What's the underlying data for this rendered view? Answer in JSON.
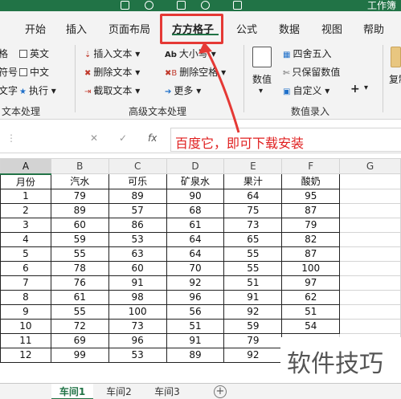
{
  "title_bar": {
    "title": "工作簿"
  },
  "tabs": [
    "开始",
    "插入",
    "页面布局",
    "方方格子",
    "公式",
    "数据",
    "视图",
    "帮助"
  ],
  "active_tab": "方方格子",
  "ribbon": {
    "left_items": [
      "格",
      "符号",
      "文字"
    ],
    "check_items": [
      "英文",
      "中文"
    ],
    "exec_label": "执行",
    "text_group_label": "文本处理",
    "adv_items": {
      "insert_text": "插入文本",
      "delete_text": "删除文本",
      "cut_text": "截取文本",
      "case": "大小写",
      "delete_space": "删除空格",
      "more": "更多"
    },
    "adv_group_label": "高级文本处理",
    "num_label": "数值",
    "round_label": "四舍五入",
    "keep_value_label": "只保留数值",
    "custom_label": "自定义",
    "num_group_label": "数值录入",
    "copy_label": "复制"
  },
  "formula_bar": {
    "cancel_symbol": "✕",
    "enter_symbol": "✓",
    "fx_symbol": "fx",
    "value": "百度它，即可下载安装"
  },
  "sheet": {
    "columns": [
      "A",
      "B",
      "C",
      "D",
      "E",
      "F",
      "G"
    ],
    "headers": [
      "月份",
      "汽水",
      "可乐",
      "矿泉水",
      "果汁",
      "酸奶"
    ],
    "rows": [
      [
        "1",
        "79",
        "89",
        "90",
        "64",
        "95"
      ],
      [
        "2",
        "89",
        "57",
        "68",
        "75",
        "87"
      ],
      [
        "3",
        "60",
        "86",
        "61",
        "73",
        "79"
      ],
      [
        "4",
        "59",
        "53",
        "64",
        "65",
        "82"
      ],
      [
        "5",
        "55",
        "63",
        "64",
        "55",
        "87"
      ],
      [
        "6",
        "78",
        "60",
        "70",
        "55",
        "100"
      ],
      [
        "7",
        "76",
        "91",
        "92",
        "51",
        "97"
      ],
      [
        "8",
        "61",
        "98",
        "96",
        "91",
        "62"
      ],
      [
        "9",
        "55",
        "100",
        "56",
        "92",
        "51"
      ],
      [
        "10",
        "72",
        "73",
        "51",
        "59",
        "54"
      ],
      [
        "11",
        "69",
        "96",
        "91",
        "79",
        ""
      ],
      [
        "12",
        "99",
        "53",
        "89",
        "92",
        ""
      ]
    ]
  },
  "sheet_tabs": [
    "车间1",
    "车间2",
    "车间3"
  ],
  "add_sheet_symbol": "+",
  "watermark": "软件技巧"
}
